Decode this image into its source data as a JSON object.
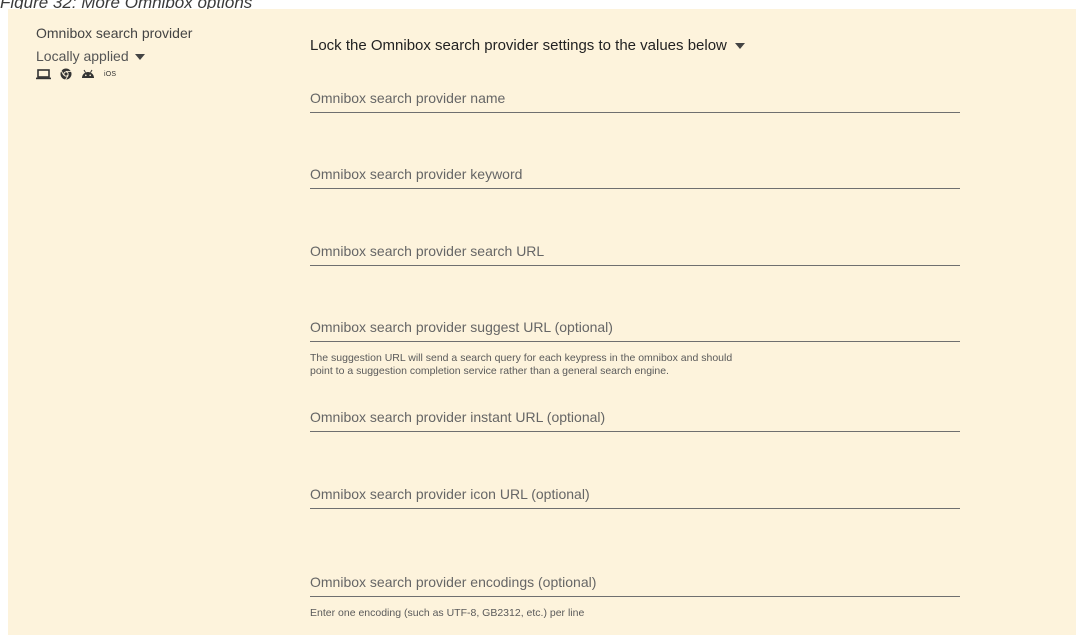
{
  "caption": "Figure 32: More Omnibox options",
  "policy": {
    "title": "Omnibox search provider",
    "scope": "Locally applied",
    "platforms": [
      "laptop-icon",
      "chrome-icon",
      "android-icon",
      "ios-icon"
    ],
    "ios_label": "iOS"
  },
  "mode_label": "Lock the Omnibox search provider settings to the values below",
  "fields": [
    {
      "placeholder": "Omnibox search provider name",
      "value": ""
    },
    {
      "placeholder": "Omnibox search provider keyword",
      "value": ""
    },
    {
      "placeholder": "Omnibox search provider search URL",
      "value": ""
    },
    {
      "placeholder": "Omnibox search provider suggest URL (optional)",
      "value": ""
    },
    {
      "placeholder": "Omnibox search provider instant URL (optional)",
      "value": ""
    },
    {
      "placeholder": "Omnibox search provider icon URL (optional)",
      "value": ""
    },
    {
      "placeholder": "Omnibox search provider encodings (optional)",
      "value": ""
    }
  ],
  "hints": {
    "suggest_line1": "The suggestion URL will send a search query for each keypress in the omnibox and should",
    "suggest_line2": "point to a suggestion completion service rather than a general search engine.",
    "encodings": "Enter one encoding (such as UTF-8, GB2312, etc.) per line"
  },
  "colors": {
    "panel_background": "#fdf3dc",
    "underline": "#6f6f6f",
    "placeholder_text": "#666666"
  }
}
